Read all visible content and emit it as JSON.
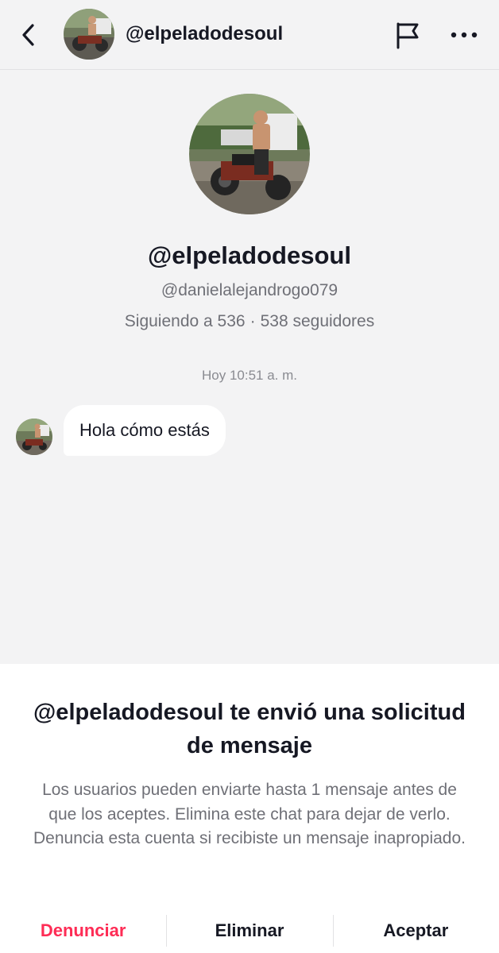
{
  "header": {
    "username": "@elpeladodesoul",
    "icons": [
      "back-icon",
      "flag-icon",
      "more-icon"
    ]
  },
  "profile": {
    "display_name": "@elpeladodesoul",
    "handle": "@danielalejandrogo079",
    "following_label": "Siguiendo a 536",
    "separator": "·",
    "followers_label": "538 seguidores"
  },
  "chat": {
    "timestamp": "Hoy 10:51 a. m.",
    "messages": [
      {
        "text": "Hola cómo estás"
      }
    ]
  },
  "request_sheet": {
    "title": "@elpeladodesoul te envió una solicitud de mensaje",
    "description": "Los usuarios pueden enviarte hasta 1 mensaje antes de que los aceptes. Elimina este chat para dejar de verlo. Denuncia esta cuenta si recibiste un mensaje inapropiado.",
    "actions": {
      "report": "Denunciar",
      "delete": "Eliminar",
      "accept": "Aceptar"
    }
  },
  "colors": {
    "background": "#f3f3f4",
    "sheet": "#ffffff",
    "primary_text": "#161823",
    "secondary_text": "#6f7077",
    "report_red": "#fe2c55"
  }
}
